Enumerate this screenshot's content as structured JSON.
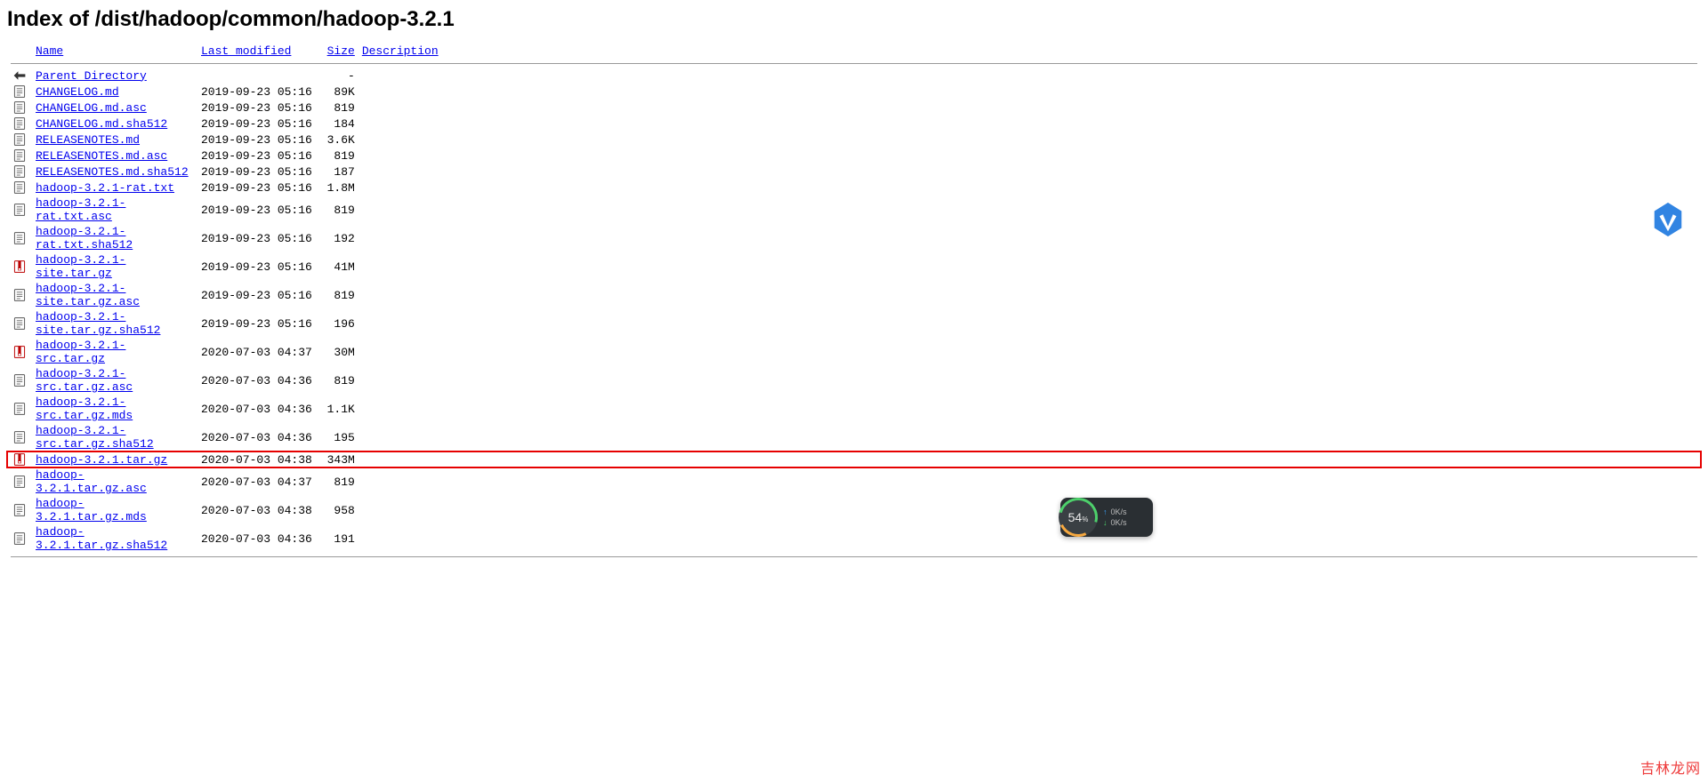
{
  "title": "Index of /dist/hadoop/common/hadoop-3.2.1",
  "headers": {
    "name": "Name",
    "last_modified": "Last modified",
    "size": "Size",
    "description": "Description"
  },
  "parent": {
    "label": "Parent Directory",
    "size": "-"
  },
  "files": [
    {
      "icon": "text",
      "name": "CHANGELOG.md",
      "modified": "2019-09-23 05:16",
      "size": "89K",
      "highlight": false
    },
    {
      "icon": "text",
      "name": "CHANGELOG.md.asc",
      "modified": "2019-09-23 05:16",
      "size": "819",
      "highlight": false
    },
    {
      "icon": "text",
      "name": "CHANGELOG.md.sha512",
      "modified": "2019-09-23 05:16",
      "size": "184",
      "highlight": false
    },
    {
      "icon": "text",
      "name": "RELEASENOTES.md",
      "modified": "2019-09-23 05:16",
      "size": "3.6K",
      "highlight": false
    },
    {
      "icon": "text",
      "name": "RELEASENOTES.md.asc",
      "modified": "2019-09-23 05:16",
      "size": "819",
      "highlight": false
    },
    {
      "icon": "text",
      "name": "RELEASENOTES.md.sha512",
      "modified": "2019-09-23 05:16",
      "size": "187",
      "highlight": false
    },
    {
      "icon": "text",
      "name": "hadoop-3.2.1-rat.txt",
      "modified": "2019-09-23 05:16",
      "size": "1.8M",
      "highlight": false
    },
    {
      "icon": "text",
      "name": "hadoop-3.2.1-rat.txt.asc",
      "modified": "2019-09-23 05:16",
      "size": "819",
      "highlight": false
    },
    {
      "icon": "text",
      "name": "hadoop-3.2.1-rat.txt.sha512",
      "modified": "2019-09-23 05:16",
      "size": "192",
      "highlight": false
    },
    {
      "icon": "archive",
      "name": "hadoop-3.2.1-site.tar.gz",
      "modified": "2019-09-23 05:16",
      "size": "41M",
      "highlight": false
    },
    {
      "icon": "text",
      "name": "hadoop-3.2.1-site.tar.gz.asc",
      "modified": "2019-09-23 05:16",
      "size": "819",
      "highlight": false
    },
    {
      "icon": "text",
      "name": "hadoop-3.2.1-site.tar.gz.sha512",
      "modified": "2019-09-23 05:16",
      "size": "196",
      "highlight": false
    },
    {
      "icon": "archive",
      "name": "hadoop-3.2.1-src.tar.gz",
      "modified": "2020-07-03 04:37",
      "size": "30M",
      "highlight": false
    },
    {
      "icon": "text",
      "name": "hadoop-3.2.1-src.tar.gz.asc",
      "modified": "2020-07-03 04:36",
      "size": "819",
      "highlight": false
    },
    {
      "icon": "text",
      "name": "hadoop-3.2.1-src.tar.gz.mds",
      "modified": "2020-07-03 04:36",
      "size": "1.1K",
      "highlight": false
    },
    {
      "icon": "text",
      "name": "hadoop-3.2.1-src.tar.gz.sha512",
      "modified": "2020-07-03 04:36",
      "size": "195",
      "highlight": false
    },
    {
      "icon": "archive",
      "name": "hadoop-3.2.1.tar.gz",
      "modified": "2020-07-03 04:38",
      "size": "343M",
      "highlight": true
    },
    {
      "icon": "text",
      "name": "hadoop-3.2.1.tar.gz.asc",
      "modified": "2020-07-03 04:37",
      "size": "819",
      "highlight": false
    },
    {
      "icon": "text",
      "name": "hadoop-3.2.1.tar.gz.mds",
      "modified": "2020-07-03 04:38",
      "size": "958",
      "highlight": false
    },
    {
      "icon": "text",
      "name": "hadoop-3.2.1.tar.gz.sha512",
      "modified": "2020-07-03 04:36",
      "size": "191",
      "highlight": false
    }
  ],
  "speed_widget": {
    "percent": "54",
    "percent_sign": "%",
    "up": "0K/s",
    "down": "0K/s"
  },
  "watermark": "吉林龙网"
}
